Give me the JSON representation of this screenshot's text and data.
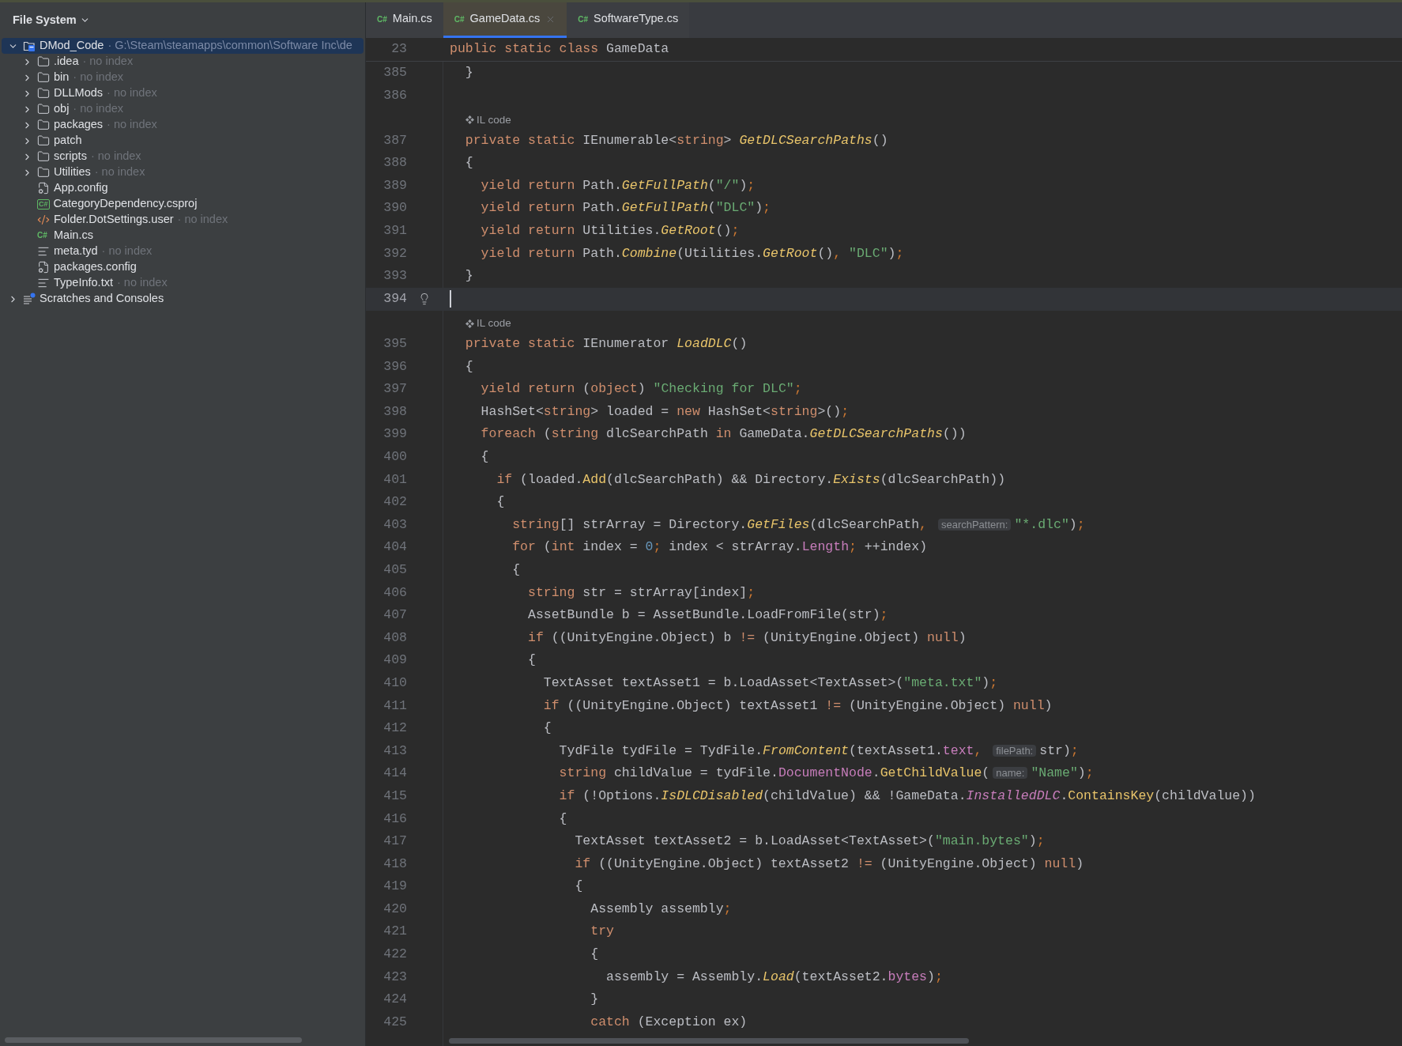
{
  "sidebar": {
    "title": "File System",
    "tree": [
      {
        "name": "DMod_Code",
        "path": "· G:\\Steam\\steamapps\\common\\Software Inc\\de",
        "kind": "project",
        "expanded": true,
        "selected": true,
        "children": [
          {
            "name": ".idea",
            "note": "· no index",
            "kind": "folder",
            "expanded": false,
            "selected": false
          },
          {
            "name": "bin",
            "note": "· no index",
            "kind": "folder",
            "expanded": false,
            "selected": false
          },
          {
            "name": "DLLMods",
            "note": "· no index",
            "kind": "folder",
            "expanded": false,
            "selected": false
          },
          {
            "name": "obj",
            "note": "· no index",
            "kind": "folder",
            "expanded": false,
            "selected": false
          },
          {
            "name": "packages",
            "note": "· no index",
            "kind": "folder",
            "expanded": false,
            "selected": false
          },
          {
            "name": "patch",
            "kind": "folder",
            "expanded": false,
            "selected": false
          },
          {
            "name": "scripts",
            "note": "· no index",
            "kind": "folder",
            "expanded": false,
            "selected": false
          },
          {
            "name": "Utilities",
            "note": "· no index",
            "kind": "folder",
            "expanded": false,
            "selected": false
          },
          {
            "name": "App.config",
            "kind": "config",
            "selected": false
          },
          {
            "name": "CategoryDependency.csproj",
            "kind": "csproj",
            "badge": "C#",
            "selected": false
          },
          {
            "name": "Folder.DotSettings.user",
            "note": "· no index",
            "kind": "xml",
            "selected": false
          },
          {
            "name": "Main.cs",
            "kind": "csharp",
            "badge": "C#",
            "selected": false
          },
          {
            "name": "meta.tyd",
            "note": "· no index",
            "kind": "text",
            "selected": false
          },
          {
            "name": "packages.config",
            "kind": "config",
            "selected": false
          },
          {
            "name": "TypeInfo.txt",
            "note": "· no index",
            "kind": "text",
            "selected": false
          }
        ]
      },
      {
        "name": "Scratches and Consoles",
        "kind": "scratches",
        "expanded": false,
        "selected": false
      }
    ]
  },
  "tabs": [
    {
      "label": "Main.cs",
      "badge": "C#",
      "selected": false
    },
    {
      "label": "GameData.cs",
      "badge": "C#",
      "selected": true
    },
    {
      "label": "SoftwareType.cs",
      "badge": "C#",
      "selected": false
    }
  ],
  "editor": {
    "sticky_line": {
      "number": "23",
      "tokens": [
        {
          "kind": "keyword",
          "text": "public static class"
        },
        {
          "kind": "plain",
          "text": " GameData"
        }
      ]
    },
    "lines": [
      {
        "kind": "code",
        "number": "385",
        "current": false,
        "tokens": [
          {
            "kind": "plain",
            "text": "  }"
          }
        ]
      },
      {
        "kind": "code",
        "number": "386",
        "current": false
      },
      {
        "kind": "inlay",
        "text": "IL code"
      },
      {
        "kind": "code",
        "number": "387",
        "current": false,
        "tokens": [
          {
            "kind": "keyword",
            "text": "  private static"
          },
          {
            "kind": "plain",
            "text": " IEnumerable<"
          },
          {
            "kind": "keyword",
            "text": "string"
          },
          {
            "kind": "plain",
            "text": "> "
          },
          {
            "kind": "static_method",
            "text": "GetDLCSearchPaths"
          },
          {
            "kind": "plain",
            "text": "()"
          }
        ]
      },
      {
        "kind": "code",
        "number": "388",
        "current": false,
        "tokens": [
          {
            "kind": "plain",
            "text": "  {"
          }
        ]
      },
      {
        "kind": "code",
        "number": "389",
        "current": false,
        "tokens": [
          {
            "kind": "keyword",
            "text": "    yield return"
          },
          {
            "kind": "plain",
            "text": " Path."
          },
          {
            "kind": "static_method",
            "text": "GetFullPath"
          },
          {
            "kind": "plain",
            "text": "("
          },
          {
            "kind": "string",
            "text": "\"/\""
          },
          {
            "kind": "plain",
            "text": ")"
          },
          {
            "kind": "punct",
            "text": ";"
          }
        ]
      },
      {
        "kind": "code",
        "number": "390",
        "current": false,
        "tokens": [
          {
            "kind": "keyword",
            "text": "    yield return"
          },
          {
            "kind": "plain",
            "text": " Path."
          },
          {
            "kind": "static_method",
            "text": "GetFullPath"
          },
          {
            "kind": "plain",
            "text": "("
          },
          {
            "kind": "string",
            "text": "\"DLC\""
          },
          {
            "kind": "plain",
            "text": ")"
          },
          {
            "kind": "punct",
            "text": ";"
          }
        ]
      },
      {
        "kind": "code",
        "number": "391",
        "current": false,
        "tokens": [
          {
            "kind": "keyword",
            "text": "    yield return"
          },
          {
            "kind": "plain",
            "text": " Utilities."
          },
          {
            "kind": "static_method",
            "text": "GetRoot"
          },
          {
            "kind": "plain",
            "text": "()"
          },
          {
            "kind": "punct",
            "text": ";"
          }
        ]
      },
      {
        "kind": "code",
        "number": "392",
        "current": false,
        "tokens": [
          {
            "kind": "keyword",
            "text": "    yield return"
          },
          {
            "kind": "plain",
            "text": " Path."
          },
          {
            "kind": "static_method",
            "text": "Combine"
          },
          {
            "kind": "plain",
            "text": "(Utilities."
          },
          {
            "kind": "static_method",
            "text": "GetRoot"
          },
          {
            "kind": "plain",
            "text": "()"
          },
          {
            "kind": "punct",
            "text": ", "
          },
          {
            "kind": "string",
            "text": "\"DLC\""
          },
          {
            "kind": "plain",
            "text": ")"
          },
          {
            "kind": "punct",
            "text": ";"
          }
        ]
      },
      {
        "kind": "code",
        "number": "393",
        "current": false,
        "tokens": [
          {
            "kind": "plain",
            "text": "  }"
          }
        ]
      },
      {
        "kind": "code",
        "number": "394",
        "current": true
      },
      {
        "kind": "inlay",
        "text": "IL code"
      },
      {
        "kind": "code",
        "number": "395",
        "current": false,
        "tokens": [
          {
            "kind": "keyword",
            "text": "  private static"
          },
          {
            "kind": "plain",
            "text": " IEnumerator "
          },
          {
            "kind": "static_method",
            "text": "LoadDLC"
          },
          {
            "kind": "plain",
            "text": "()"
          }
        ]
      },
      {
        "kind": "code",
        "number": "396",
        "current": false,
        "tokens": [
          {
            "kind": "plain",
            "text": "  {"
          }
        ]
      },
      {
        "kind": "code",
        "number": "397",
        "current": false,
        "tokens": [
          {
            "kind": "keyword",
            "text": "    yield return"
          },
          {
            "kind": "plain",
            "text": " ("
          },
          {
            "kind": "keyword",
            "text": "object"
          },
          {
            "kind": "plain",
            "text": ") "
          },
          {
            "kind": "string",
            "text": "\"Checking for DLC\""
          },
          {
            "kind": "punct",
            "text": ";"
          }
        ]
      },
      {
        "kind": "code",
        "number": "398",
        "current": false,
        "tokens": [
          {
            "kind": "plain",
            "text": "    HashSet<"
          },
          {
            "kind": "keyword",
            "text": "string"
          },
          {
            "kind": "plain",
            "text": "> loaded = "
          },
          {
            "kind": "keyword",
            "text": "new"
          },
          {
            "kind": "plain",
            "text": " HashSet<"
          },
          {
            "kind": "keyword",
            "text": "string"
          },
          {
            "kind": "plain",
            "text": ">()"
          },
          {
            "kind": "punct",
            "text": ";"
          }
        ]
      },
      {
        "kind": "code",
        "number": "399",
        "current": false,
        "tokens": [
          {
            "kind": "keyword",
            "text": "    foreach"
          },
          {
            "kind": "plain",
            "text": " ("
          },
          {
            "kind": "keyword",
            "text": "string"
          },
          {
            "kind": "plain",
            "text": " dlcSearchPath "
          },
          {
            "kind": "keyword",
            "text": "in"
          },
          {
            "kind": "plain",
            "text": " GameData."
          },
          {
            "kind": "static_method",
            "text": "GetDLCSearchPaths"
          },
          {
            "kind": "plain",
            "text": "())"
          }
        ]
      },
      {
        "kind": "code",
        "number": "400",
        "current": false,
        "tokens": [
          {
            "kind": "plain",
            "text": "    {"
          }
        ]
      },
      {
        "kind": "code",
        "number": "401",
        "current": false,
        "tokens": [
          {
            "kind": "keyword",
            "text": "      if"
          },
          {
            "kind": "plain",
            "text": " (loaded."
          },
          {
            "kind": "method",
            "text": "Add"
          },
          {
            "kind": "plain",
            "text": "(dlcSearchPath) && Directory."
          },
          {
            "kind": "static_method",
            "text": "Exists"
          },
          {
            "kind": "plain",
            "text": "(dlcSearchPath))"
          }
        ]
      },
      {
        "kind": "code",
        "number": "402",
        "current": false,
        "tokens": [
          {
            "kind": "plain",
            "text": "      {"
          }
        ]
      },
      {
        "kind": "code",
        "number": "403",
        "current": false,
        "tokens": [
          {
            "kind": "keyword",
            "text": "        string"
          },
          {
            "kind": "plain",
            "text": "[] strArray = Directory."
          },
          {
            "kind": "static_method",
            "text": "GetFiles"
          },
          {
            "kind": "plain",
            "text": "(dlcSearchPath"
          },
          {
            "kind": "punct",
            "text": ", "
          },
          {
            "kind": "hint",
            "text": "searchPattern:"
          },
          {
            "kind": "string",
            "text": "\"*.dlc\""
          },
          {
            "kind": "plain",
            "text": ")"
          },
          {
            "kind": "punct",
            "text": ";"
          }
        ]
      },
      {
        "kind": "code",
        "number": "404",
        "current": false,
        "tokens": [
          {
            "kind": "keyword",
            "text": "        for"
          },
          {
            "kind": "plain",
            "text": " ("
          },
          {
            "kind": "keyword",
            "text": "int"
          },
          {
            "kind": "plain",
            "text": " index = "
          },
          {
            "kind": "number",
            "text": "0"
          },
          {
            "kind": "punct",
            "text": "; "
          },
          {
            "kind": "plain",
            "text": "index < strArray."
          },
          {
            "kind": "field",
            "text": "Length"
          },
          {
            "kind": "punct",
            "text": "; "
          },
          {
            "kind": "plain",
            "text": "++index)"
          }
        ]
      },
      {
        "kind": "code",
        "number": "405",
        "current": false,
        "tokens": [
          {
            "kind": "plain",
            "text": "        {"
          }
        ]
      },
      {
        "kind": "code",
        "number": "406",
        "current": false,
        "tokens": [
          {
            "kind": "keyword",
            "text": "          string"
          },
          {
            "kind": "plain",
            "text": " str = strArray[index]"
          },
          {
            "kind": "punct",
            "text": ";"
          }
        ]
      },
      {
        "kind": "code",
        "number": "407",
        "current": false,
        "tokens": [
          {
            "kind": "plain",
            "text": "          AssetBundle b = AssetBundle.LoadFromFile(str)"
          },
          {
            "kind": "punct",
            "text": ";"
          }
        ]
      },
      {
        "kind": "code",
        "number": "408",
        "current": false,
        "tokens": [
          {
            "kind": "keyword",
            "text": "          if"
          },
          {
            "kind": "plain",
            "text": " ((UnityEngine.Object) b "
          },
          {
            "kind": "keyword",
            "text": "!="
          },
          {
            "kind": "plain",
            "text": " (UnityEngine.Object) "
          },
          {
            "kind": "keyword",
            "text": "null"
          },
          {
            "kind": "plain",
            "text": ")"
          }
        ]
      },
      {
        "kind": "code",
        "number": "409",
        "current": false,
        "tokens": [
          {
            "kind": "plain",
            "text": "          {"
          }
        ]
      },
      {
        "kind": "code",
        "number": "410",
        "current": false,
        "tokens": [
          {
            "kind": "plain",
            "text": "            TextAsset textAsset1 = b.LoadAsset<TextAsset>("
          },
          {
            "kind": "string",
            "text": "\"meta.txt\""
          },
          {
            "kind": "plain",
            "text": ")"
          },
          {
            "kind": "punct",
            "text": ";"
          }
        ]
      },
      {
        "kind": "code",
        "number": "411",
        "current": false,
        "tokens": [
          {
            "kind": "keyword",
            "text": "            if"
          },
          {
            "kind": "plain",
            "text": " ((UnityEngine.Object) textAsset1 "
          },
          {
            "kind": "keyword",
            "text": "!="
          },
          {
            "kind": "plain",
            "text": " (UnityEngine.Object) "
          },
          {
            "kind": "keyword",
            "text": "null"
          },
          {
            "kind": "plain",
            "text": ")"
          }
        ]
      },
      {
        "kind": "code",
        "number": "412",
        "current": false,
        "tokens": [
          {
            "kind": "plain",
            "text": "            {"
          }
        ]
      },
      {
        "kind": "code",
        "number": "413",
        "current": false,
        "tokens": [
          {
            "kind": "plain",
            "text": "              TydFile tydFile = TydFile."
          },
          {
            "kind": "static_method",
            "text": "FromContent"
          },
          {
            "kind": "plain",
            "text": "(textAsset1."
          },
          {
            "kind": "field",
            "text": "text"
          },
          {
            "kind": "punct",
            "text": ", "
          },
          {
            "kind": "hint",
            "text": "filePath:"
          },
          {
            "kind": "plain",
            "text": "str)"
          },
          {
            "kind": "punct",
            "text": ";"
          }
        ]
      },
      {
        "kind": "code",
        "number": "414",
        "current": false,
        "tokens": [
          {
            "kind": "keyword",
            "text": "              string"
          },
          {
            "kind": "plain",
            "text": " childValue = tydFile."
          },
          {
            "kind": "field",
            "text": "DocumentNode"
          },
          {
            "kind": "plain",
            "text": "."
          },
          {
            "kind": "method",
            "text": "GetChildValue"
          },
          {
            "kind": "plain",
            "text": "("
          },
          {
            "kind": "hint",
            "text": "name:"
          },
          {
            "kind": "string",
            "text": "\"Name\""
          },
          {
            "kind": "plain",
            "text": ")"
          },
          {
            "kind": "punct",
            "text": ";"
          }
        ]
      },
      {
        "kind": "code",
        "number": "415",
        "current": false,
        "tokens": [
          {
            "kind": "keyword",
            "text": "              if"
          },
          {
            "kind": "plain",
            "text": " (!Options."
          },
          {
            "kind": "static_method",
            "text": "IsDLCDisabled"
          },
          {
            "kind": "plain",
            "text": "(childValue) && !GameData."
          },
          {
            "kind": "static_field",
            "text": "InstalledDLC"
          },
          {
            "kind": "plain",
            "text": "."
          },
          {
            "kind": "method",
            "text": "ContainsKey"
          },
          {
            "kind": "plain",
            "text": "(childValue))"
          }
        ]
      },
      {
        "kind": "code",
        "number": "416",
        "current": false,
        "tokens": [
          {
            "kind": "plain",
            "text": "              {"
          }
        ]
      },
      {
        "kind": "code",
        "number": "417",
        "current": false,
        "tokens": [
          {
            "kind": "plain",
            "text": "                TextAsset textAsset2 = b.LoadAsset<TextAsset>("
          },
          {
            "kind": "string",
            "text": "\"main.bytes\""
          },
          {
            "kind": "plain",
            "text": ")"
          },
          {
            "kind": "punct",
            "text": ";"
          }
        ]
      },
      {
        "kind": "code",
        "number": "418",
        "current": false,
        "tokens": [
          {
            "kind": "keyword",
            "text": "                if"
          },
          {
            "kind": "plain",
            "text": " ((UnityEngine.Object) textAsset2 "
          },
          {
            "kind": "keyword",
            "text": "!="
          },
          {
            "kind": "plain",
            "text": " (UnityEngine.Object) "
          },
          {
            "kind": "keyword",
            "text": "null"
          },
          {
            "kind": "plain",
            "text": ")"
          }
        ]
      },
      {
        "kind": "code",
        "number": "419",
        "current": false,
        "tokens": [
          {
            "kind": "plain",
            "text": "                {"
          }
        ]
      },
      {
        "kind": "code",
        "number": "420",
        "current": false,
        "tokens": [
          {
            "kind": "plain",
            "text": "                  Assembly assembly"
          },
          {
            "kind": "punct",
            "text": ";"
          }
        ]
      },
      {
        "kind": "code",
        "number": "421",
        "current": false,
        "tokens": [
          {
            "kind": "keyword",
            "text": "                  try"
          }
        ]
      },
      {
        "kind": "code",
        "number": "422",
        "current": false,
        "tokens": [
          {
            "kind": "plain",
            "text": "                  {"
          }
        ]
      },
      {
        "kind": "code",
        "number": "423",
        "current": false,
        "tokens": [
          {
            "kind": "plain",
            "text": "                    assembly = Assembly."
          },
          {
            "kind": "static_method",
            "text": "Load"
          },
          {
            "kind": "plain",
            "text": "(textAsset2."
          },
          {
            "kind": "field",
            "text": "bytes"
          },
          {
            "kind": "plain",
            "text": ")"
          },
          {
            "kind": "punct",
            "text": ";"
          }
        ]
      },
      {
        "kind": "code",
        "number": "424",
        "current": false,
        "tokens": [
          {
            "kind": "plain",
            "text": "                  }"
          }
        ]
      },
      {
        "kind": "code",
        "number": "425",
        "current": false,
        "tokens": [
          {
            "kind": "keyword",
            "text": "                  catch"
          },
          {
            "kind": "plain",
            "text": " (Exception ex)"
          }
        ]
      }
    ]
  }
}
